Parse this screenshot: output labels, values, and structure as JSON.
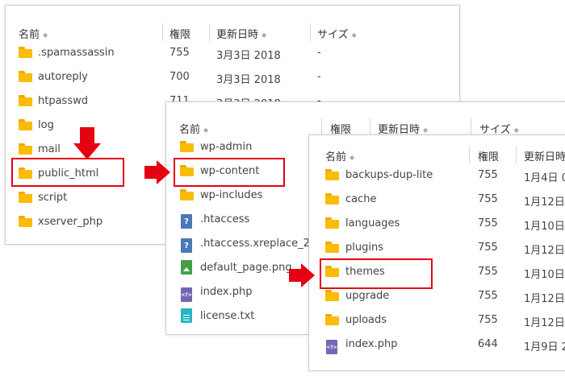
{
  "panel1": {
    "headers": {
      "name": "名前",
      "perm": "権限",
      "date": "更新日時",
      "size": "サイズ"
    },
    "rows": [
      {
        "name": ".spamassassin",
        "perm": "755",
        "date": "3月3日 2018",
        "size": "-"
      },
      {
        "name": "autoreply",
        "perm": "700",
        "date": "3月3日 2018",
        "size": "-"
      },
      {
        "name": "htpasswd",
        "perm": "711",
        "date": "3月3日 2018",
        "size": "-"
      },
      {
        "name": "log"
      },
      {
        "name": "mail"
      },
      {
        "name": "public_html"
      },
      {
        "name": "script"
      },
      {
        "name": "xserver_php"
      }
    ]
  },
  "panel2": {
    "headers": {
      "name": "名前",
      "perm": "権限",
      "date": "更新日時",
      "size": "サイズ"
    },
    "rows": [
      {
        "name": "wp-admin",
        "icon": "folder-icon"
      },
      {
        "name": "wp-content",
        "icon": "folder-icon"
      },
      {
        "name": "wp-includes",
        "icon": "folder-icon"
      },
      {
        "name": ".htaccess",
        "icon": "unknown-file-icon"
      },
      {
        "name": ".htaccess.xreplace_2...",
        "icon": "unknown-file-icon"
      },
      {
        "name": "default_page.png",
        "icon": "image-file-icon"
      },
      {
        "name": "index.php",
        "icon": "php-file-icon"
      },
      {
        "name": "license.txt",
        "icon": "text-file-icon"
      }
    ]
  },
  "panel3": {
    "headers": {
      "name": "名前",
      "perm": "権限",
      "date": "更新日時"
    },
    "rows": [
      {
        "name": "backups-dup-lite",
        "perm": "755",
        "date": "1月4日 0",
        "icon": "folder-icon"
      },
      {
        "name": "cache",
        "perm": "755",
        "date": "1月12日",
        "icon": "folder-icon"
      },
      {
        "name": "languages",
        "perm": "755",
        "date": "1月10日",
        "icon": "folder-icon"
      },
      {
        "name": "plugins",
        "perm": "755",
        "date": "1月12日",
        "icon": "folder-icon"
      },
      {
        "name": "themes",
        "perm": "755",
        "date": "1月10日",
        "icon": "folder-icon"
      },
      {
        "name": "upgrade",
        "perm": "755",
        "date": "1月12日",
        "icon": "folder-icon"
      },
      {
        "name": "uploads",
        "perm": "755",
        "date": "1月12日",
        "icon": "folder-icon"
      },
      {
        "name": "index.php",
        "perm": "644",
        "date": "1月9日 2",
        "icon": "php-file-icon"
      }
    ]
  },
  "colors": {
    "accent_red": "#e50012",
    "folder": "#fbbc04"
  },
  "glyphs": {
    "sort": "◆",
    "question": "?",
    "php": "<?>"
  }
}
